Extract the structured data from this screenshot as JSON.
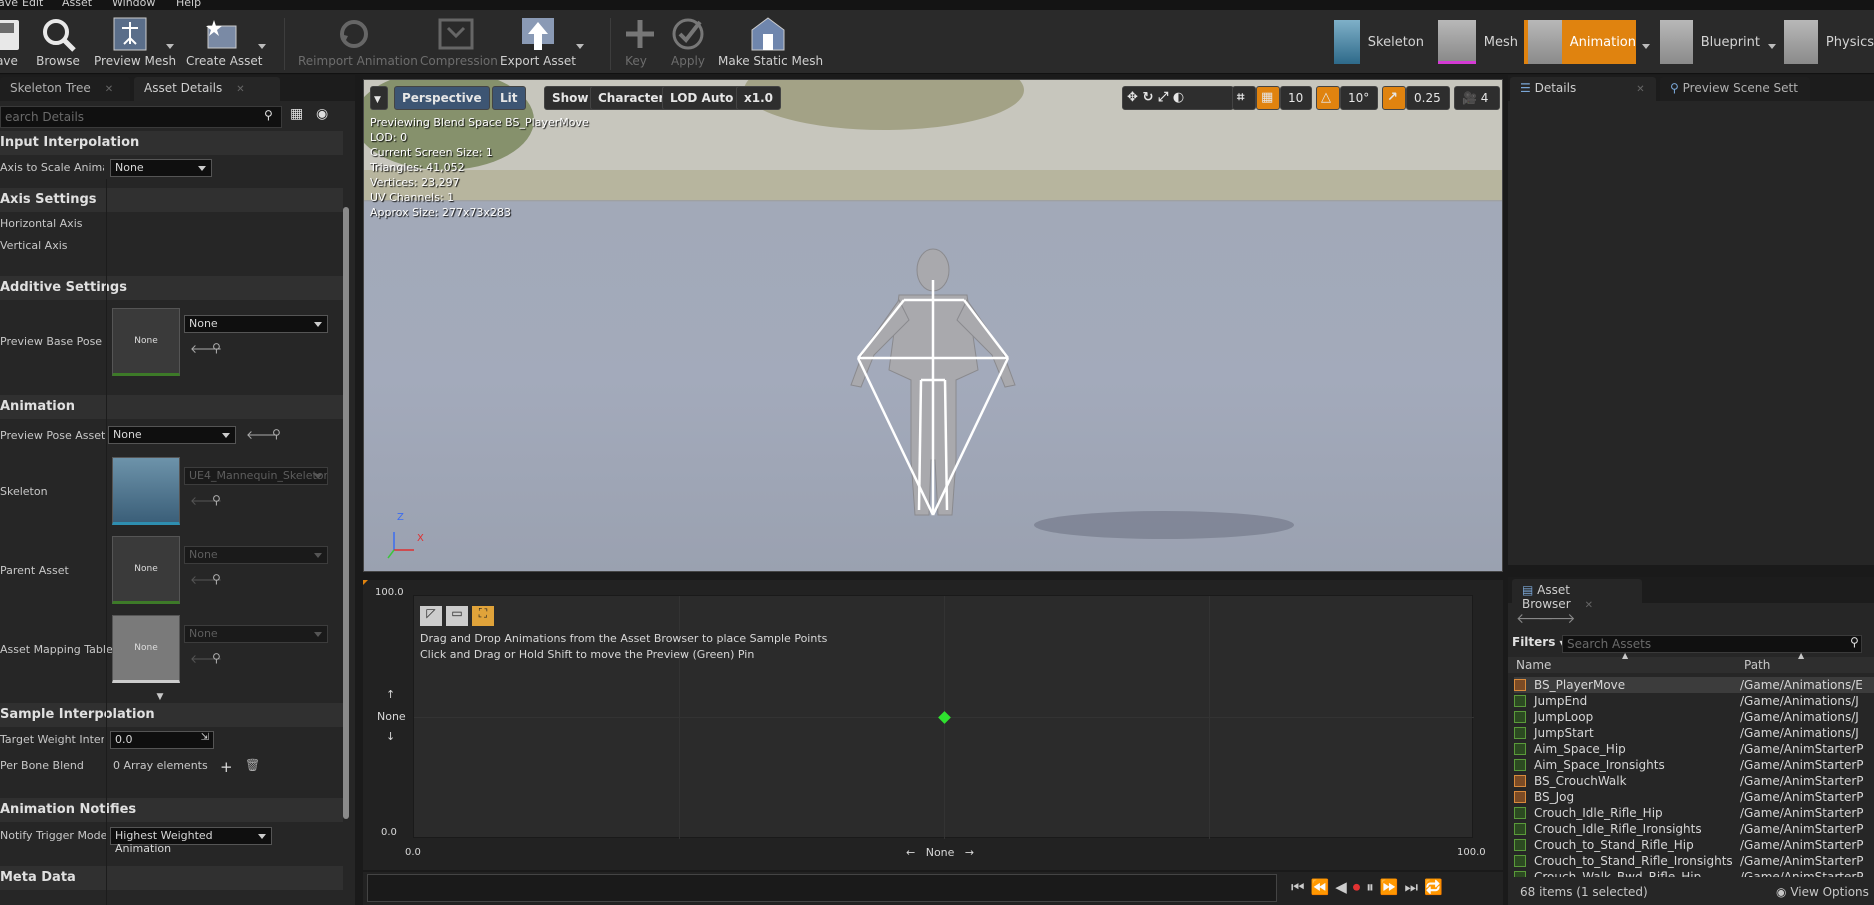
{
  "menu": [
    "ave",
    "Edit",
    "Asset",
    "Window",
    "Help"
  ],
  "toolbar": {
    "save": "ave",
    "browse": "Browse",
    "preview_mesh": "Preview Mesh",
    "create_asset": "Create Asset",
    "reimport": "Reimport Animation",
    "compression": "Compression",
    "export_asset": "Export Asset",
    "key": "Key",
    "apply": "Apply",
    "make_static_mesh": "Make Static Mesh"
  },
  "modes": {
    "skeleton": "Skeleton",
    "mesh": "Mesh",
    "animation": "Animation",
    "blueprint": "Blueprint",
    "physics": "Physics"
  },
  "left": {
    "tab_skeleton_tree": "Skeleton Tree",
    "tab_asset_details": "Asset Details",
    "search_placeholder": "earch Details",
    "cat_input_interp": "Input Interpolation",
    "axis_to_scale": "Axis to Scale Animati",
    "axis_to_scale_value": "None",
    "cat_axis_settings": "Axis Settings",
    "horizontal_axis": "Horizontal Axis",
    "vertical_axis": "Vertical Axis",
    "cat_additive": "Additive Settings",
    "preview_base_pose": "Preview Base Pose",
    "preview_base_pose_value": "None",
    "thumb_none": "None",
    "cat_animation": "Animation",
    "preview_pose_asset": "Preview Pose Asset",
    "preview_pose_value": "None",
    "skeleton": "Skeleton",
    "skeleton_value": "UE4_Mannequin_Skeleton",
    "parent_asset": "Parent Asset",
    "parent_value": "None",
    "asset_mapping": "Asset Mapping Table",
    "asset_mapping_value": "None",
    "cat_sample_interp": "Sample Interpolation",
    "target_weight": "Target Weight Interpo",
    "target_weight_value": "0.0",
    "per_bone": "Per Bone Blend",
    "per_bone_value": "0 Array elements",
    "cat_notifies": "Animation Notifies",
    "notify_trigger": "Notify Trigger Mode",
    "notify_value": "Highest Weighted Animation",
    "cat_meta": "Meta Data"
  },
  "viewport": {
    "perspective": "Perspective",
    "lit": "Lit",
    "show": "Show",
    "character": "Character",
    "lod": "LOD Auto",
    "speed": "x1.0",
    "grid_val": "10",
    "rot_val": "10°",
    "scale_val": "0.25",
    "cam_val": "4",
    "info": [
      "Previewing Blend Space BS_PlayerMove",
      "LOD: 0",
      "Current Screen Size: 1",
      "Triangles: 41,052",
      "Vertices: 23,297",
      "UV Channels: 1",
      "Approx Size: 277x73x283"
    ],
    "axis_z": "Z",
    "axis_x": "X"
  },
  "blend": {
    "y_max": "100.0",
    "y_min": "0.0",
    "x_min": "0.0",
    "x_max": "100.0",
    "y_name": "None",
    "x_name": "None",
    "hint1": "Drag and Drop Animations from the Asset Browser to place Sample Points",
    "hint2": "Click and Drag or Hold Shift to move the Preview (Green) Pin"
  },
  "right": {
    "tab_details": "Details",
    "tab_preview": "Preview Scene Sett"
  },
  "assets": {
    "tab": "Asset Browser",
    "filters": "Filters",
    "search_placeholder": "Search Assets",
    "col_name": "Name",
    "col_path": "Path",
    "items": [
      {
        "name": "BS_PlayerMove",
        "path": "/Game/Animations/E",
        "kind": "bs"
      },
      {
        "name": "JumpEnd",
        "path": "/Game/Animations/J",
        "kind": "anim"
      },
      {
        "name": "JumpLoop",
        "path": "/Game/Animations/J",
        "kind": "anim"
      },
      {
        "name": "JumpStart",
        "path": "/Game/Animations/J",
        "kind": "anim"
      },
      {
        "name": "Aim_Space_Hip",
        "path": "/Game/AnimStarterP",
        "kind": "anim"
      },
      {
        "name": "Aim_Space_Ironsights",
        "path": "/Game/AnimStarterP",
        "kind": "anim"
      },
      {
        "name": "BS_CrouchWalk",
        "path": "/Game/AnimStarterP",
        "kind": "bs"
      },
      {
        "name": "BS_Jog",
        "path": "/Game/AnimStarterP",
        "kind": "bs"
      },
      {
        "name": "Crouch_Idle_Rifle_Hip",
        "path": "/Game/AnimStarterP",
        "kind": "anim"
      },
      {
        "name": "Crouch_Idle_Rifle_Ironsights",
        "path": "/Game/AnimStarterP",
        "kind": "anim"
      },
      {
        "name": "Crouch_to_Stand_Rifle_Hip",
        "path": "/Game/AnimStarterP",
        "kind": "anim"
      },
      {
        "name": "Crouch_to_Stand_Rifle_Ironsights",
        "path": "/Game/AnimStarterP",
        "kind": "anim"
      },
      {
        "name": "Crouch_Walk_Bwd_Rifle_Hip",
        "path": "/Game/AnimStarterP",
        "kind": "anim"
      }
    ],
    "count": "68 items (1 selected)",
    "view_options": "View Options"
  },
  "colors": {
    "accent": "#e0830f",
    "pin": "#2fe12f"
  }
}
